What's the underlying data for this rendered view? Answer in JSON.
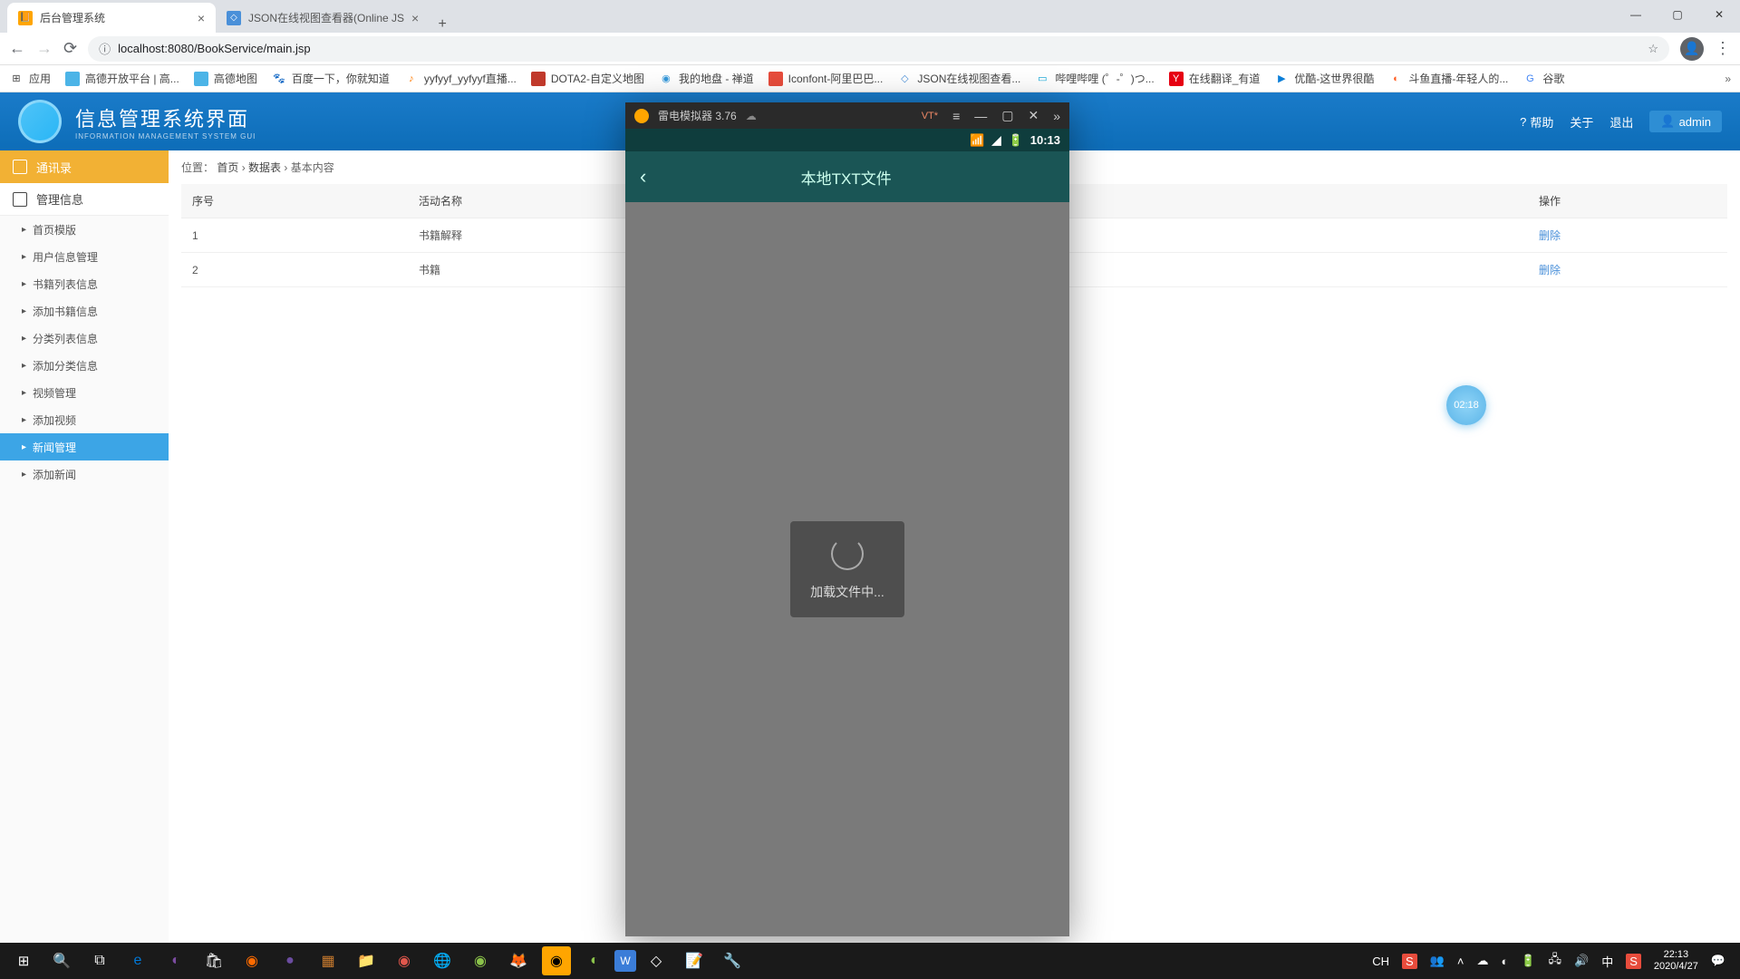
{
  "browser": {
    "tabs": [
      {
        "title": "后台管理系统",
        "favicon": "📙"
      },
      {
        "title": "JSON在线视图查看器(Online JS",
        "favicon": "<>"
      }
    ],
    "url": "localhost:8080/BookService/main.jsp",
    "bookmarks": [
      {
        "label": "应用",
        "ico": ""
      },
      {
        "label": "高德开放平台 | 高...",
        "ico": "🔶"
      },
      {
        "label": "高德地图",
        "ico": "🔶"
      },
      {
        "label": "百度一下，你就知道",
        "ico": "🐾"
      },
      {
        "label": "yyfyyf_yyfyyf直播...",
        "ico": "🎵"
      },
      {
        "label": "DOTA2-自定义地图",
        "ico": "🟥"
      },
      {
        "label": "我的地盘 - 禅道",
        "ico": "🔵"
      },
      {
        "label": "Iconfont-阿里巴巴...",
        "ico": "🟧"
      },
      {
        "label": "JSON在线视图查看...",
        "ico": "<>"
      },
      {
        "label": "哔哩哔哩 (゜-゜)つ...",
        "ico": "📺"
      },
      {
        "label": "在线翻译_有道",
        "ico": "Y"
      },
      {
        "label": "优酷-这世界很酷",
        "ico": "▶"
      },
      {
        "label": "斗鱼直播-年轻人的...",
        "ico": "🐟"
      },
      {
        "label": "谷歌",
        "ico": "G"
      }
    ]
  },
  "app": {
    "title": "信息管理系统界面",
    "subtitle": "INFORMATION MANAGEMENT SYSTEM GUI",
    "header_links": {
      "help": "帮助",
      "about": "关于",
      "logout": "退出"
    },
    "user": "admin"
  },
  "sidebar": {
    "cat1": "通讯录",
    "cat2": "管理信息",
    "items": [
      "首页模版",
      "用户信息管理",
      "书籍列表信息",
      "添加书籍信息",
      "分类列表信息",
      "添加分类信息",
      "视频管理",
      "添加视频",
      "新闻管理",
      "添加新闻"
    ],
    "active_index": 8
  },
  "breadcrumb": {
    "label": "位置：",
    "home": "首页",
    "p1": "数据表",
    "p2": "基本内容"
  },
  "table": {
    "headers": [
      "序号",
      "活动名称",
      "操作"
    ],
    "rows": [
      {
        "id": "1",
        "name": "书籍解释",
        "action": "删除"
      },
      {
        "id": "2",
        "name": "书籍",
        "action": "删除"
      }
    ]
  },
  "emulator": {
    "title": "雷电模拟器 3.76",
    "vt": "VT*",
    "phone_time": "10:13",
    "page_title": "本地TXT文件",
    "loading": "加载文件中...",
    "float_badge": "02:18"
  },
  "taskbar": {
    "lang": "CH",
    "time": "22:13",
    "date": "2020/4/27"
  }
}
